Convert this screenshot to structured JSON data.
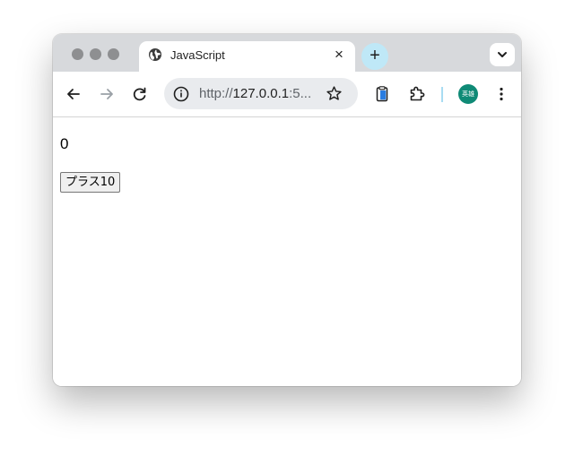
{
  "browser": {
    "tab": {
      "title": "JavaScript",
      "close_glyph": "×",
      "icon": "globe-icon"
    },
    "new_tab_glyph": "+",
    "address_bar": {
      "url_prefix": "http://",
      "url_host": "127.0.0.1",
      "url_rest": ":5...",
      "icon": "info-icon"
    },
    "profile": {
      "initials": "英雄",
      "color": "#0f8a76"
    },
    "toolbar_icons": [
      "back-arrow-icon",
      "forward-arrow-icon",
      "reload-icon",
      "star-icon",
      "clipboard-icon",
      "extensions-puzzle-icon",
      "kebab-menu-icon"
    ],
    "accent_color": "#bfe8f7"
  },
  "page": {
    "counter_value": "0",
    "plus_button_label": "プラス10"
  }
}
